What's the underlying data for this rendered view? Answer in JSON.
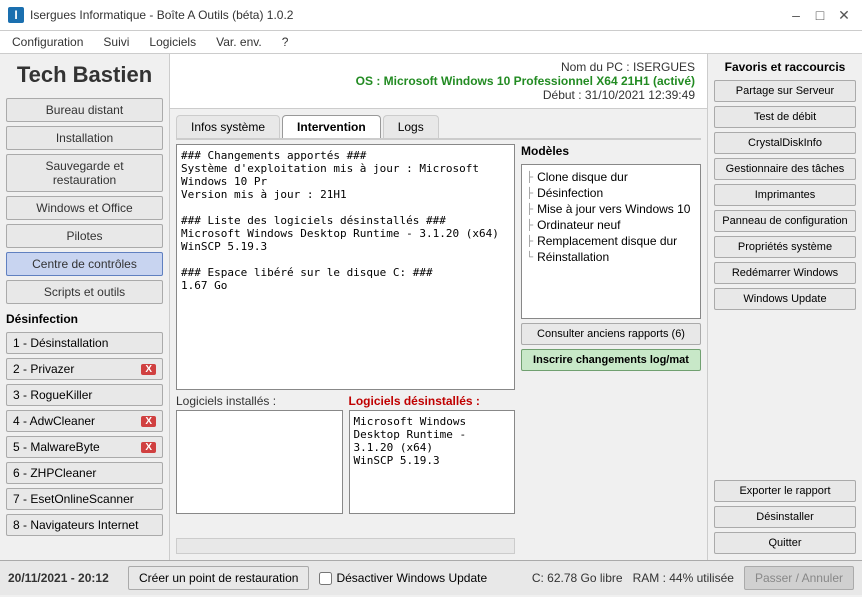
{
  "titlebar": {
    "icon": "I",
    "title": "Isergues Informatique - Boîte A Outils (béta) 1.0.2",
    "min": "–",
    "max": "□",
    "close": "✕"
  },
  "menu": {
    "items": [
      "Configuration",
      "Suivi",
      "Logiciels",
      "Var. env.",
      "?"
    ]
  },
  "app_title": "Tech Bastien",
  "left_buttons": [
    {
      "label": "Bureau distant"
    },
    {
      "label": "Installation"
    },
    {
      "label": "Sauvegarde et restauration"
    },
    {
      "label": "Windows et Office"
    },
    {
      "label": "Pilotes"
    },
    {
      "label": "Centre de contrôles",
      "active": true
    },
    {
      "label": "Scripts et outils"
    }
  ],
  "desinfection": {
    "title": "Désinfection",
    "items": [
      {
        "label": "1 - Désinstallation",
        "badge": null
      },
      {
        "label": "2 - Privazer",
        "badge": "X"
      },
      {
        "label": "3 - RogueKiller",
        "badge": null
      },
      {
        "label": "4 - AdwCleaner",
        "badge": "X"
      },
      {
        "label": "5 - MalwareByte",
        "badge": "X"
      },
      {
        "label": "6 - ZHPCleaner",
        "badge": null
      },
      {
        "label": "7 - EsetOnlineScanner",
        "badge": null
      },
      {
        "label": "8 - Navigateurs Internet",
        "badge": null
      }
    ]
  },
  "pc_info": {
    "nom_pc": "Nom du PC : ISERGUES",
    "os": "OS : Microsoft Windows 10 Professionnel X64 21H1 (activé)",
    "debut": "Début : 31/10/2021 12:39:49"
  },
  "tabs": [
    "Infos système",
    "Intervention",
    "Logs"
  ],
  "active_tab": "Intervention",
  "intervention": {
    "changelog": "### Changements apportés ###\nSystème d'exploitation mis à jour : Microsoft Windows 10 Pr\nVersion mis à jour : 21H1\n\n### Liste des logiciels désinstallés ###\nMicrosoft Windows Desktop Runtime - 3.1.20 (x64)\nWinSCP 5.19.3\n\n### Espace libéré sur le disque C: ###\n1.67 Go",
    "models_title": "Modèles",
    "models": [
      "Clone disque dur",
      "Désinfection",
      "Mise à jour vers Windows 10",
      "Ordinateur neuf",
      "Remplacement disque dur",
      "Réinstallation"
    ],
    "consult_btn": "Consulter anciens rapports (6)",
    "log_btn": "Inscrire changements log/mat",
    "installed_label": "Logiciels installés :",
    "installed_content": "",
    "uninstalled_label": "Logiciels désinstallés :",
    "uninstalled_content": "Microsoft Windows Desktop Runtime - 3.1.20 (x64)\nWinSCP 5.19.3"
  },
  "right_panel": {
    "title": "Favoris et raccourcis",
    "buttons": [
      "Partage sur Serveur",
      "Test de débit",
      "CrystalDiskInfo",
      "Gestionnaire des tâches",
      "Imprimantes",
      "Panneau de configuration",
      "Propriétés système",
      "Redémarrer Windows",
      "Windows Update"
    ],
    "export_btn": "Exporter le rapport",
    "uninstall_btn": "Désinstaller",
    "quit_btn": "Quitter",
    "pass_btn": "Passer / Annuler"
  },
  "bottom": {
    "date": "20/11/2021 - 20:12",
    "restore_btn": "Créer un point de restauration",
    "checkbox_label": "Désactiver Windows Update",
    "disk": "C: 62.78 Go libre",
    "ram": "RAM : 44% utilisée"
  }
}
